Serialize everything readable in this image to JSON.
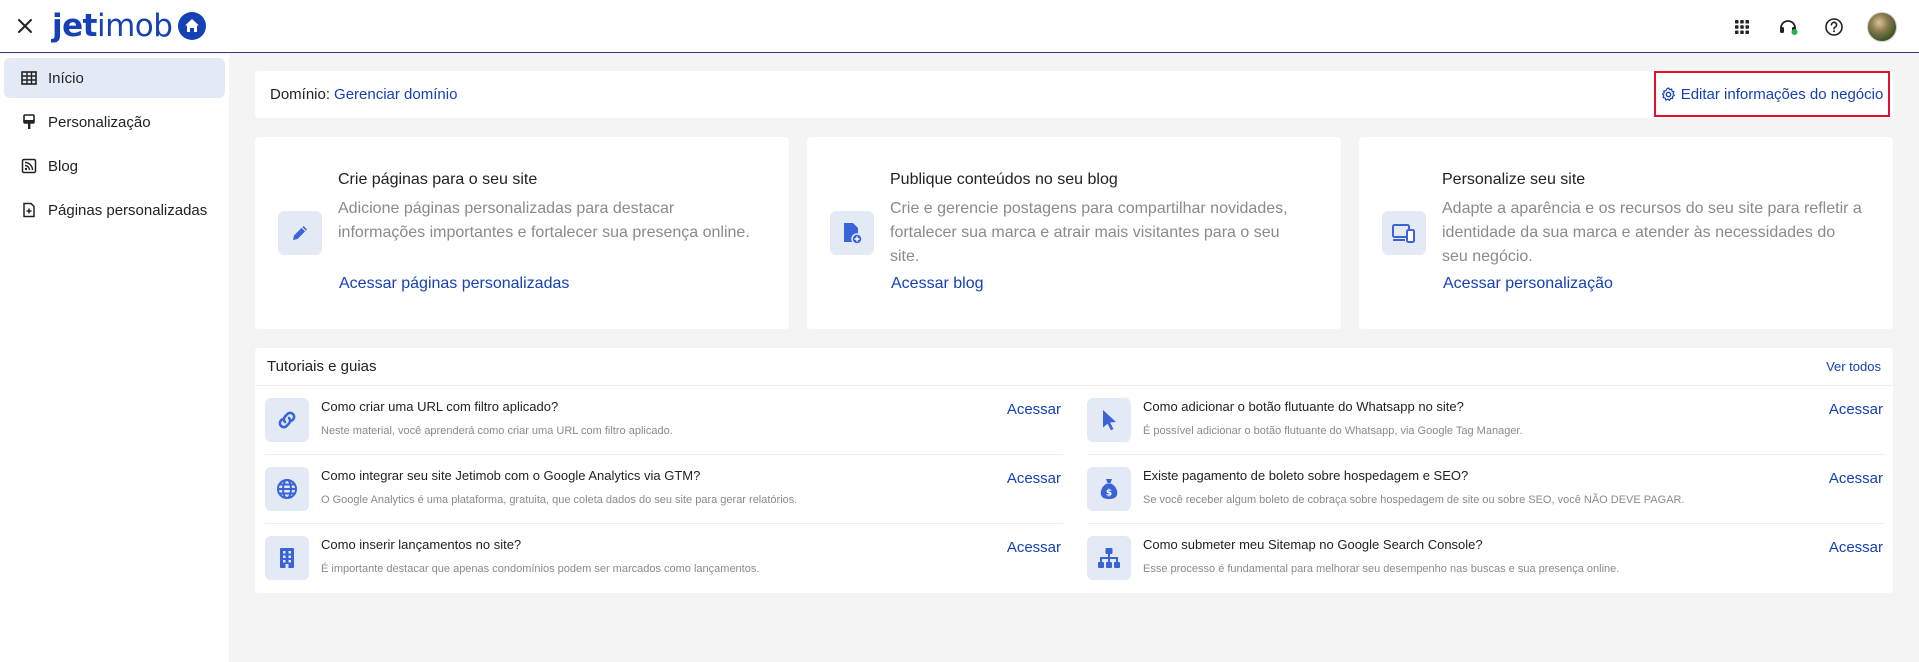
{
  "header": {
    "logo_bold": "jet",
    "logo_light": "imob",
    "icons": [
      "close-icon",
      "apps-grid-icon",
      "support-headset-icon",
      "help-icon",
      "avatar"
    ]
  },
  "sidebar": {
    "items": [
      {
        "label": "Início",
        "icon": "table-grid-icon",
        "active": true
      },
      {
        "label": "Personalização",
        "icon": "paint-roller-icon",
        "active": false
      },
      {
        "label": "Blog",
        "icon": "rss-icon",
        "active": false
      },
      {
        "label": "Páginas personalizadas",
        "icon": "file-plus-icon",
        "active": false
      }
    ]
  },
  "domain": {
    "label": "Domínio:",
    "manage_link": "Gerenciar domínio",
    "edit_button": "Editar informações do negócio"
  },
  "cards": [
    {
      "title": "Crie páginas para o seu site",
      "desc": "Adicione páginas personalizadas para destacar informações importantes e fortalecer sua presença online.",
      "link": "Acessar páginas personalizadas",
      "icon": "pencil-icon"
    },
    {
      "title": "Publique conteúdos no seu blog",
      "desc": "Crie e gerencie postagens para compartilhar novidades, fortalecer sua marca e atrair mais visitantes para o seu site.",
      "link": "Acessar blog",
      "icon": "file-add-icon"
    },
    {
      "title": "Personalize seu site",
      "desc": "Adapte a aparência e os recursos do seu site para refletir a identidade da sua marca e atender às necessidades do seu negócio.",
      "link": "Acessar personalização",
      "icon": "devices-icon"
    }
  ],
  "tutorials": {
    "title": "Tutoriais e guias",
    "see_all": "Ver todos",
    "action_label": "Acessar",
    "items": [
      {
        "q": "Como criar uma URL com filtro aplicado?",
        "d": "Neste material, você aprenderá como criar uma URL com filtro aplicado.",
        "icon": "link-icon"
      },
      {
        "q": "Como adicionar o botão flutuante do Whatsapp no site?",
        "d": "É possível adicionar o botão flutuante do Whatsapp, via Google Tag Manager.",
        "icon": "cursor-icon"
      },
      {
        "q": "Como integrar seu site Jetimob com o Google Analytics via GTM?",
        "d": "O Google Analytics é uma plataforma, gratuita, que coleta dados do seu site para gerar relatórios.",
        "icon": "globe-icon"
      },
      {
        "q": "Existe pagamento de boleto sobre hospedagem e SEO?",
        "d": "Se você receber algum boleto de cobraça sobre hospedagem de site ou sobre SEO, você NÃO DEVE PAGAR.",
        "icon": "money-bag-icon"
      },
      {
        "q": "Como inserir lançamentos no site?",
        "d": "É importante destacar que apenas condomínios podem ser marcados como lançamentos.",
        "icon": "building-icon"
      },
      {
        "q": "Como submeter meu Sitemap no Google Search Console?",
        "d": "Esse processo é fundamental para melhorar seu desempenho nas buscas e sua presença online.",
        "icon": "sitemap-icon"
      }
    ]
  },
  "colors": {
    "brand": "#1541b5",
    "highlight_border": "#e0102e",
    "icon_bg": "#e4e9f6"
  }
}
